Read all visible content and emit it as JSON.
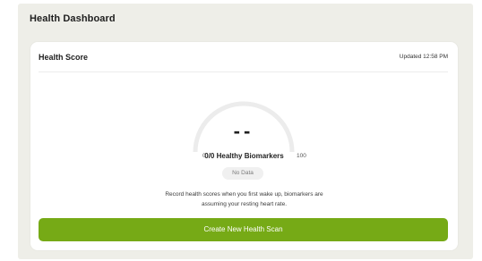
{
  "page": {
    "title": "Health Dashboard"
  },
  "health_score": {
    "title": "Health Score",
    "updated": "Updated 12:58 PM",
    "score_value": "--",
    "scale_min": "0",
    "scale_max": "100",
    "biomarkers": "0/0 Healthy Biomarkers",
    "status_badge": "No Data",
    "hint_line_1": "Record health scores when you first wake up, biomarkers are",
    "hint_line_2": "assuming your resting heart rate.",
    "gauge_level": 0
  },
  "actions": {
    "create_scan": "Create New Health Scan"
  },
  "colors": {
    "accent": "#76aa16",
    "background": "#eeeee8",
    "card": "#ffffff",
    "gauge_track": "#ececec"
  }
}
